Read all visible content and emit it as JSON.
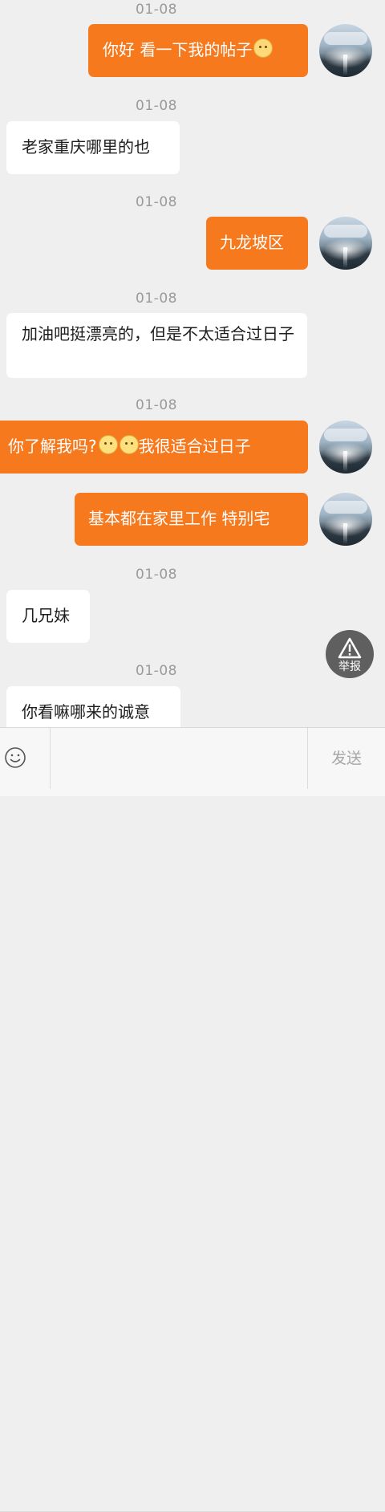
{
  "messages": [
    {
      "time": "01-08",
      "direction": "out",
      "text": "你好 看一下我的帖子",
      "emoji": "cat-face-emoji"
    },
    {
      "time": "01-08",
      "direction": "in",
      "text": "老家重庆哪里的也"
    },
    {
      "time": "01-08",
      "direction": "out",
      "text": "九龙坡区"
    },
    {
      "time": "01-08",
      "direction": "in",
      "text": "加油吧挺漂亮的，但是不太适合过日子"
    },
    {
      "time": "01-08",
      "direction": "out",
      "text_before": "你了解我吗?",
      "text_after": "我很适合过日子",
      "emoji": "laugh-crying-emoji"
    },
    {
      "direction": "out",
      "text": "基本都在家里工作 特别宅"
    },
    {
      "time": "01-08",
      "direction": "in",
      "text": "几兄妹"
    },
    {
      "time": "01-08",
      "direction": "in",
      "text": "你看嘛哪来的诚意"
    }
  ],
  "report": {
    "label": "举报",
    "icon": "warning-triangle-icon"
  },
  "input": {
    "placeholder": "",
    "send_label": "发送",
    "emoji_icon": "smiley-icon"
  },
  "colors": {
    "outgoing": "#f7791e",
    "incoming": "#ffffff",
    "background": "#efefef"
  }
}
